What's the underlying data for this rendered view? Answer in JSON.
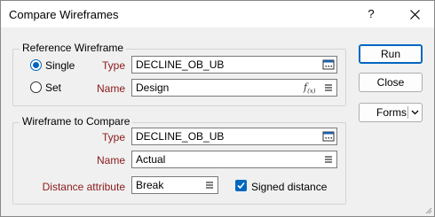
{
  "window": {
    "title": "Compare Wireframes",
    "help_label": "?"
  },
  "reference": {
    "group_label": "Reference Wireframe",
    "options": [
      {
        "label": "Single",
        "checked": true
      },
      {
        "label": "Set",
        "checked": false
      }
    ],
    "type_label": "Type",
    "type_value": "DECLINE_OB_UB",
    "name_label": "Name",
    "name_value": "Design"
  },
  "compare": {
    "group_label": "Wireframe to Compare",
    "type_label": "Type",
    "type_value": "DECLINE_OB_UB",
    "name_label": "Name",
    "name_value": "Actual",
    "distance_label": "Distance attribute",
    "distance_value": "Break",
    "signed_label": "Signed distance",
    "signed_checked": true
  },
  "buttons": {
    "run": "Run",
    "close": "Close",
    "forms": "Forms"
  },
  "colors": {
    "accent": "#0067c0",
    "label_red": "#8b1a1a"
  }
}
